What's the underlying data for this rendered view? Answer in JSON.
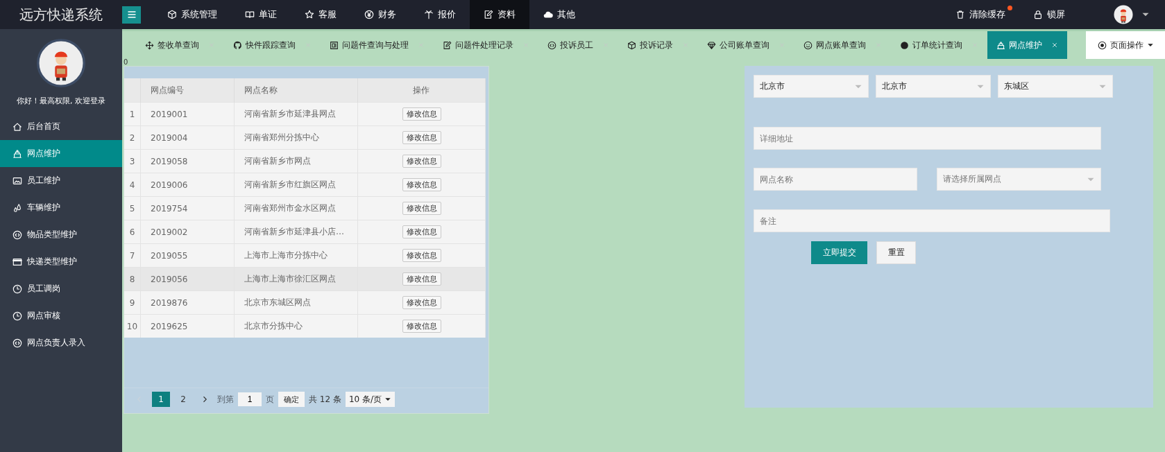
{
  "app": {
    "title": "远方快递系统"
  },
  "top_nav": [
    {
      "label": "系统管理",
      "selected": false
    },
    {
      "label": "单证",
      "selected": false
    },
    {
      "label": "客服",
      "selected": false
    },
    {
      "label": "财务",
      "selected": false
    },
    {
      "label": "报价",
      "selected": false
    },
    {
      "label": "资料",
      "selected": true
    },
    {
      "label": "其他",
      "selected": false
    }
  ],
  "top_actions": [
    {
      "label": "清除缓存",
      "badge_dot": true
    },
    {
      "label": "锁屏",
      "badge_dot": false
    }
  ],
  "sidebar": {
    "greeting": "你好！最高权限, 欢迎登录",
    "items": [
      {
        "label": "后台首页",
        "selected": false
      },
      {
        "label": "网点维护",
        "selected": true
      },
      {
        "label": "员工维护",
        "selected": false
      },
      {
        "label": "车辆维护",
        "selected": false
      },
      {
        "label": "物品类型维护",
        "selected": false
      },
      {
        "label": "快递类型维护",
        "selected": false
      },
      {
        "label": "员工调岗",
        "selected": false
      },
      {
        "label": "网点审核",
        "selected": false
      },
      {
        "label": "网点负责人录入",
        "selected": false
      }
    ]
  },
  "tabs": [
    {
      "label": "签收单查询",
      "selected": false
    },
    {
      "label": "快件跟踪查询",
      "selected": false
    },
    {
      "label": "问题件查询与处理",
      "selected": false
    },
    {
      "label": "问题件处理记录",
      "selected": false
    },
    {
      "label": "投诉员工",
      "selected": false
    },
    {
      "label": "投诉记录",
      "selected": false
    },
    {
      "label": "公司账单查询",
      "selected": false
    },
    {
      "label": "网点账单查询",
      "selected": false
    },
    {
      "label": "订单统计查询",
      "selected": false
    },
    {
      "label": "网点维护",
      "selected": true
    }
  ],
  "page_actions": {
    "label": "页面操作"
  },
  "counter": "0",
  "table": {
    "columns": [
      "网点编号",
      "网点名称",
      "操作"
    ],
    "rows": [
      {
        "index": "1",
        "code": "2019001",
        "name": "河南省新乡市延津县网点",
        "action": "修改信息",
        "highlighted": false
      },
      {
        "index": "2",
        "code": "2019004",
        "name": "河南省郑州分拣中心",
        "action": "修改信息",
        "highlighted": false
      },
      {
        "index": "3",
        "code": "2019058",
        "name": "河南省新乡市网点",
        "action": "修改信息",
        "highlighted": false
      },
      {
        "index": "4",
        "code": "2019006",
        "name": "河南省新乡市红旗区网点",
        "action": "修改信息",
        "highlighted": false
      },
      {
        "index": "5",
        "code": "2019754",
        "name": "河南省郑州市金水区网点",
        "action": "修改信息",
        "highlighted": false
      },
      {
        "index": "6",
        "code": "2019002",
        "name": "河南省新乡市延津县小店…",
        "action": "修改信息",
        "highlighted": false
      },
      {
        "index": "7",
        "code": "2019055",
        "name": "上海市上海市分拣中心",
        "action": "修改信息",
        "highlighted": false
      },
      {
        "index": "8",
        "code": "2019056",
        "name": "上海市上海市徐汇区网点",
        "action": "修改信息",
        "highlighted": true
      },
      {
        "index": "9",
        "code": "2019876",
        "name": "北京市东城区网点",
        "action": "修改信息",
        "highlighted": false
      },
      {
        "index": "10",
        "code": "2019625",
        "name": "北京市分拣中心",
        "action": "修改信息",
        "highlighted": false
      }
    ]
  },
  "pagination": {
    "pages": [
      {
        "label": "1",
        "selected": true
      },
      {
        "label": "2",
        "selected": false
      }
    ],
    "goto_label": "到第",
    "goto_value": "1",
    "page_unit": "页",
    "confirm": "确定",
    "total": "共 12 条",
    "page_size": "10 条/页"
  },
  "form": {
    "province": "北京市",
    "city": "北京市",
    "district": "东城区",
    "address_placeholder": "详细地址",
    "name_placeholder": "网点名称",
    "parent_placeholder": "请选择所属网点",
    "remark_placeholder": "备注",
    "submit": "立即提交",
    "reset": "重置"
  }
}
